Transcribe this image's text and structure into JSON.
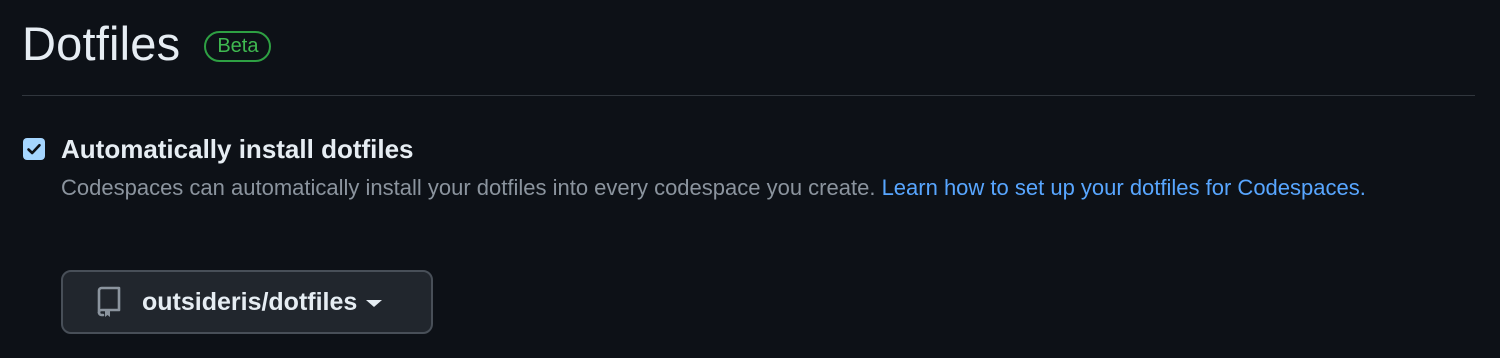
{
  "header": {
    "title": "Dotfiles",
    "badge": "Beta"
  },
  "setting": {
    "checked": true,
    "label": "Automatically install dotfiles",
    "description": "Codespaces can automatically install your dotfiles into every codespace you create. ",
    "link_text": "Learn how to set up your dotfiles for Codespaces."
  },
  "repo_select": {
    "icon": "repo-icon",
    "value": "outsideris/dotfiles",
    "caret_icon": "triangle-down-icon"
  },
  "colors": {
    "background": "#0d1117",
    "accent_link": "#58a6ff",
    "badge_green": "#3fb950",
    "checkbox_fill": "#a5d6ff"
  }
}
